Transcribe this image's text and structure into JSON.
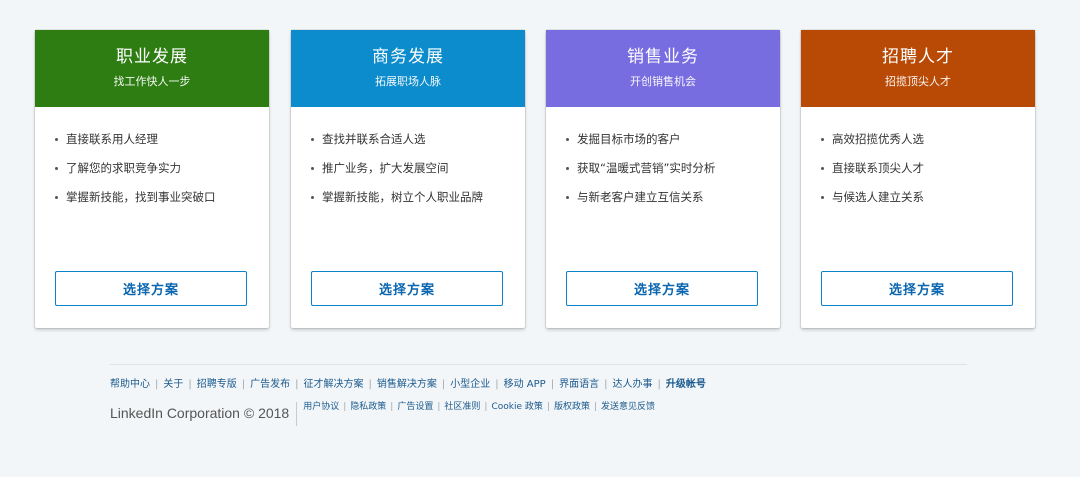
{
  "cards": [
    {
      "title": "职业发展",
      "subtitle": "找工作快人一步",
      "color": "#2e7d12",
      "features": [
        "直接联系用人经理",
        "了解您的求职竞争实力",
        "掌握新技能，找到事业突破口"
      ],
      "button": "选择方案"
    },
    {
      "title": "商务发展",
      "subtitle": "拓展职场人脉",
      "color": "#0c8ccc",
      "features": [
        "查找并联系合适人选",
        "推广业务，扩大发展空间",
        "掌握新技能，树立个人职业品牌"
      ],
      "button": "选择方案"
    },
    {
      "title": "销售业务",
      "subtitle": "开创销售机会",
      "color": "#776ce0",
      "features": [
        "发掘目标市场的客户",
        "获取“温暖式营销”实时分析",
        "与新老客户建立互信关系"
      ],
      "button": "选择方案"
    },
    {
      "title": "招聘人才",
      "subtitle": "招揽顶尖人才",
      "color": "#b94a05",
      "features": [
        "高效招揽优秀人选",
        "直接联系顶尖人才",
        "与候选人建立关系"
      ],
      "button": "选择方案"
    }
  ],
  "footer": {
    "links": [
      "帮助中心",
      "关于",
      "招聘专版",
      "广告发布",
      "征才解决方案",
      "销售解决方案",
      "小型企业",
      "移动 APP",
      "界面语言",
      "达人办事",
      "升级帐号"
    ],
    "copyright": "LinkedIn Corporation © 2018",
    "legal_links": [
      "用户协议",
      "隐私政策",
      "广告设置",
      "社区准则",
      "Cookie 政策",
      "版权政策",
      "发送意见反馈"
    ]
  }
}
